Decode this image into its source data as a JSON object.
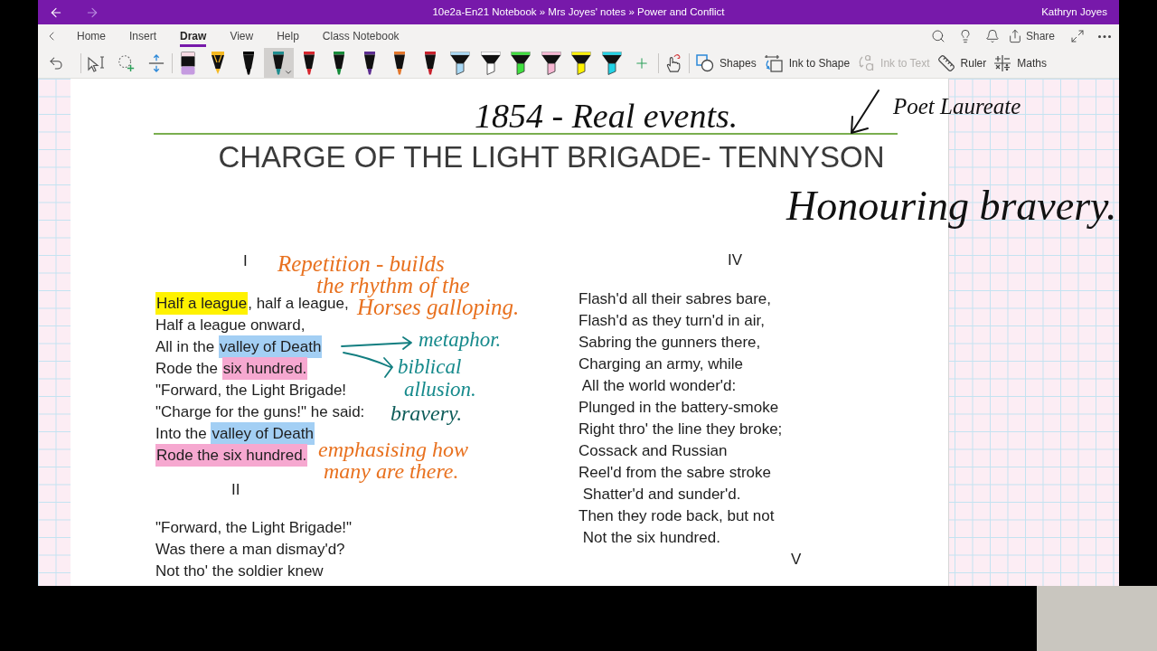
{
  "title_bar": {
    "nav_buttons": [
      {
        "kind": "back",
        "disabled": false
      },
      {
        "kind": "forward",
        "disabled": true
      }
    ],
    "title": "10e2a-En21 Notebook » Mrs Joyes' notes » Power and Conflict",
    "user": "Kathryn Joyes"
  },
  "ribbon": {
    "tabs": [
      {
        "label": "Home",
        "selected": false
      },
      {
        "label": "Insert",
        "selected": false
      },
      {
        "label": "Draw",
        "selected": true
      },
      {
        "label": "View",
        "selected": false
      },
      {
        "label": "Help",
        "selected": false
      },
      {
        "label": "Class Notebook",
        "selected": false
      }
    ],
    "share_label": "Share"
  },
  "toolbar": {
    "pens": [
      {
        "kind": "eraser",
        "color": "#c59be0",
        "selected": false
      },
      {
        "kind": "pencil",
        "color": "#f5b921",
        "selected": false
      },
      {
        "kind": "pen",
        "color": "#000000",
        "selected": false
      },
      {
        "kind": "pen",
        "color": "#1e8c8f",
        "selected": true
      },
      {
        "kind": "pen",
        "color": "#d7262e",
        "selected": false
      },
      {
        "kind": "pen",
        "color": "#168c3a",
        "selected": false
      },
      {
        "kind": "pen",
        "color": "#5c2d91",
        "selected": false
      },
      {
        "kind": "pen",
        "color": "#e3762b",
        "selected": false
      },
      {
        "kind": "pen",
        "color": "#c8212c",
        "selected": false
      },
      {
        "kind": "highlighter",
        "color": "#a9d9f5",
        "selected": false
      },
      {
        "kind": "highlighter",
        "color": "#ffffff",
        "selected": false
      },
      {
        "kind": "highlighter",
        "color": "#3fe03f",
        "selected": false
      },
      {
        "kind": "highlighter",
        "color": "#f7b7d3",
        "selected": false
      },
      {
        "kind": "highlighter",
        "color": "#fff200",
        "selected": false
      },
      {
        "kind": "highlighter",
        "color": "#22d3e6",
        "selected": false
      }
    ],
    "commands": [
      {
        "kind": "shapes",
        "label": "Shapes",
        "disabled": false
      },
      {
        "kind": "ink-to-shape",
        "label": "Ink to Shape",
        "disabled": false
      },
      {
        "kind": "ink-to-text",
        "label": "Ink to Text",
        "disabled": true
      },
      {
        "kind": "ruler",
        "label": "Ruler",
        "disabled": false
      },
      {
        "kind": "maths",
        "label": "Maths",
        "disabled": false
      }
    ]
  },
  "page": {
    "title": "CHARGE OF THE LIGHT BRIGADE- TENNYSON",
    "columns": [
      {
        "sections": [
          {
            "numeral": "I",
            "lines": [
              {
                "segments": [
                  {
                    "text": "Half a league",
                    "color": "#fff200"
                  },
                  {
                    "text": ", half a league,"
                  }
                ]
              },
              "Half a league onward,",
              {
                "segments": [
                  {
                    "text": "All in the "
                  },
                  {
                    "text": "valley of Death",
                    "color": "#a3cff4"
                  }
                ]
              },
              {
                "segments": [
                  {
                    "text": "Rode the "
                  },
                  {
                    "text": "six hundred.",
                    "color": "#f6a8d0"
                  }
                ]
              },
              "\"Forward, the Light Brigade!",
              "\"Charge for the guns!\" he said:",
              {
                "segments": [
                  {
                    "text": "Into the "
                  },
                  {
                    "text": "valley of Death",
                    "color": "#a3cff4"
                  }
                ]
              },
              {
                "segments": [
                  {
                    "text": "Rode the six hundred.",
                    "color": "#f6a8d0"
                  }
                ]
              }
            ]
          },
          {
            "numeral": "II",
            "lines": [
              "\"Forward, the Light Brigade!\"",
              "Was there a man dismay'd?",
              "Not tho' the soldier knew"
            ]
          }
        ]
      },
      {
        "sections": [
          {
            "numeral": "IV",
            "lines": [
              "Flash'd all their sabres bare,",
              "Flash'd as they turn'd in air,",
              "Sabring the gunners there,",
              "Charging an army, while",
              " All the world wonder'd:",
              "Plunged in the battery-smoke",
              "Right thro' the line they broke;",
              "Cossack and Russian",
              "Reel'd from the sabre stroke",
              " Shatter'd and sunder'd.",
              "Then they rode back, but not",
              " Not the six hundred."
            ]
          },
          {
            "numeral": "V"
          }
        ]
      }
    ]
  },
  "ink_notes": [
    {
      "color": "#111111",
      "lines": [
        "1854 - Real events."
      ]
    },
    {
      "color": "#111111",
      "lines": [
        "Poet Laureate"
      ]
    },
    {
      "color": "#111111",
      "lines": [
        "Honouring bravery."
      ]
    },
    {
      "color": "#e8711f",
      "lines": [
        "Repetition - builds",
        "the rhythm of the",
        "Horses galloping."
      ]
    },
    {
      "color": "#168a8c",
      "lines": [
        "metaphor."
      ]
    },
    {
      "color": "#168a8c",
      "lines": [
        "biblical",
        "allusion."
      ]
    },
    {
      "color": "#0e5d5a",
      "lines": [
        "bravery."
      ]
    },
    {
      "color": "#e8711f",
      "lines": [
        "emphasising how",
        "many are there."
      ]
    }
  ]
}
